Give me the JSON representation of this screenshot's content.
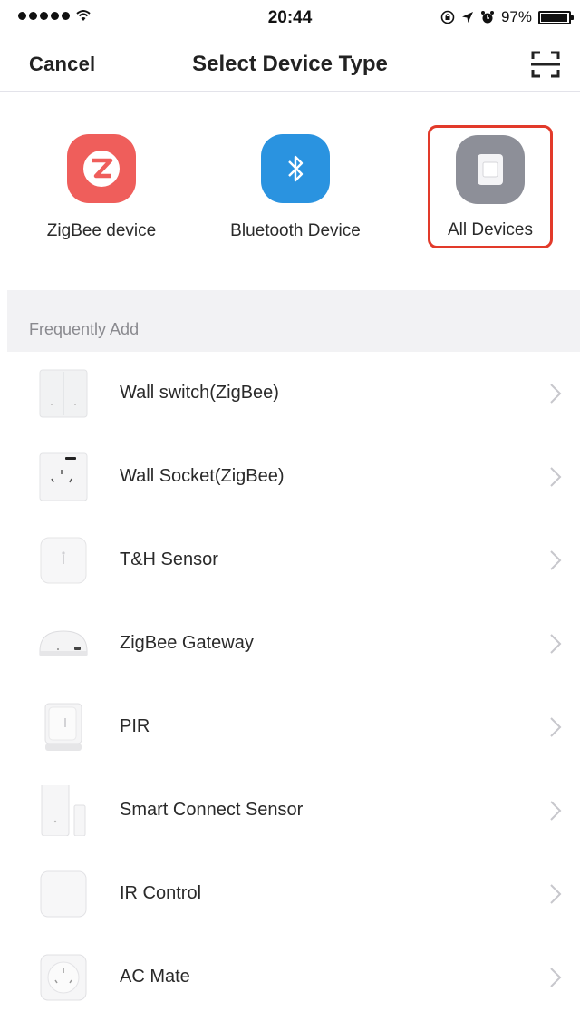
{
  "status_bar": {
    "time": "20:44",
    "battery_text": "97%",
    "battery_level": 0.97,
    "icons": [
      "signal-dots-icon",
      "wifi-icon",
      "lock-rotation-icon",
      "location-arrow-icon",
      "alarm-icon",
      "battery-icon"
    ]
  },
  "nav": {
    "cancel_label": "Cancel",
    "title": "Select Device Type",
    "scan_icon": "scan-icon"
  },
  "device_types": [
    {
      "label": "ZigBee device",
      "icon": "zigbee-icon",
      "color": "#ef5e5b"
    },
    {
      "label": "Bluetooth Device",
      "icon": "bluetooth-icon",
      "color": "#2a93e0"
    },
    {
      "label": "All Devices",
      "icon": "device-icon",
      "color": "#8d8f98",
      "selected": true
    }
  ],
  "section": {
    "title": "Frequently Add"
  },
  "devices": [
    {
      "label": "Wall switch(ZigBee)",
      "icon": "wall-switch-icon"
    },
    {
      "label": "Wall Socket(ZigBee)",
      "icon": "wall-socket-icon"
    },
    {
      "label": "T&H Sensor",
      "icon": "th-sensor-icon"
    },
    {
      "label": "ZigBee Gateway",
      "icon": "gateway-icon"
    },
    {
      "label": "PIR",
      "icon": "pir-sensor-icon"
    },
    {
      "label": "Smart Connect Sensor",
      "icon": "door-sensor-icon"
    },
    {
      "label": "IR Control",
      "icon": "ir-control-icon"
    },
    {
      "label": "AC Mate",
      "icon": "ac-mate-icon"
    }
  ],
  "colors": {
    "selection_border": "#e23a2a",
    "section_bg": "#f2f2f4"
  }
}
